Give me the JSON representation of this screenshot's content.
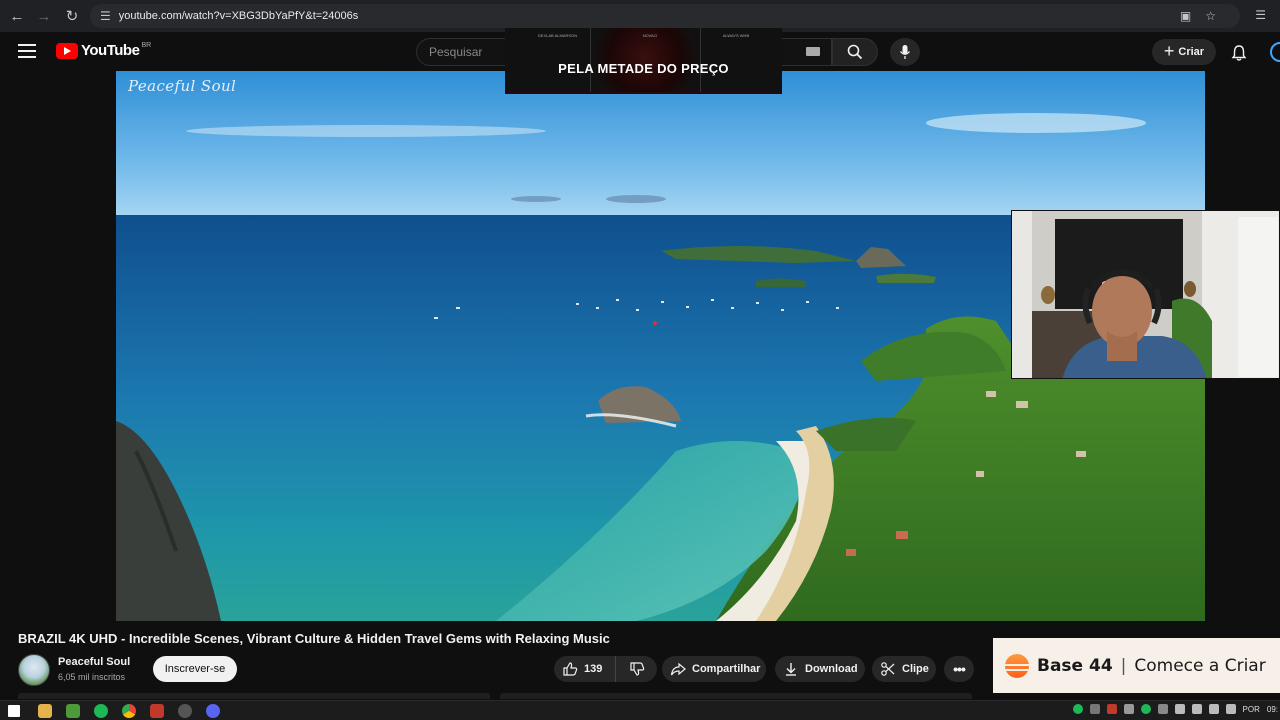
{
  "browser": {
    "url": "youtube.com/watch?v=XBG3DbYaPfY&t=24006s"
  },
  "header": {
    "logo_text": "YouTube",
    "region": "BR",
    "search_placeholder": "Pesquisar",
    "create_label": "Criar"
  },
  "promo": {
    "small_1": "DEXLAB ALMARSON",
    "small_2": "NOVAO",
    "small_3": "ALWAYS WHB",
    "headline": "PELA METADE DO PREÇO"
  },
  "video": {
    "watermark": "Peaceful Soul",
    "title": "BRAZIL 4K UHD - Incredible Scenes, Vibrant Culture & Hidden Travel Gems with Relaxing Music"
  },
  "channel": {
    "name": "Peaceful Soul",
    "subscribers": "6,05 mil inscritos",
    "subscribe_label": "Inscrever-se"
  },
  "actions": {
    "likes": "139",
    "share_label": "Compartilhar",
    "download_label": "Download",
    "clip_label": "Clipe",
    "more_label": "•••"
  },
  "ad": {
    "brand": "Base 44",
    "separator": "|",
    "cta": "Comece a Criar"
  },
  "taskbar": {
    "lang": "POR",
    "time": "09:"
  },
  "colors": {
    "accent_red": "#ff0000",
    "background": "#0f0f0f",
    "chip": "#272727"
  }
}
